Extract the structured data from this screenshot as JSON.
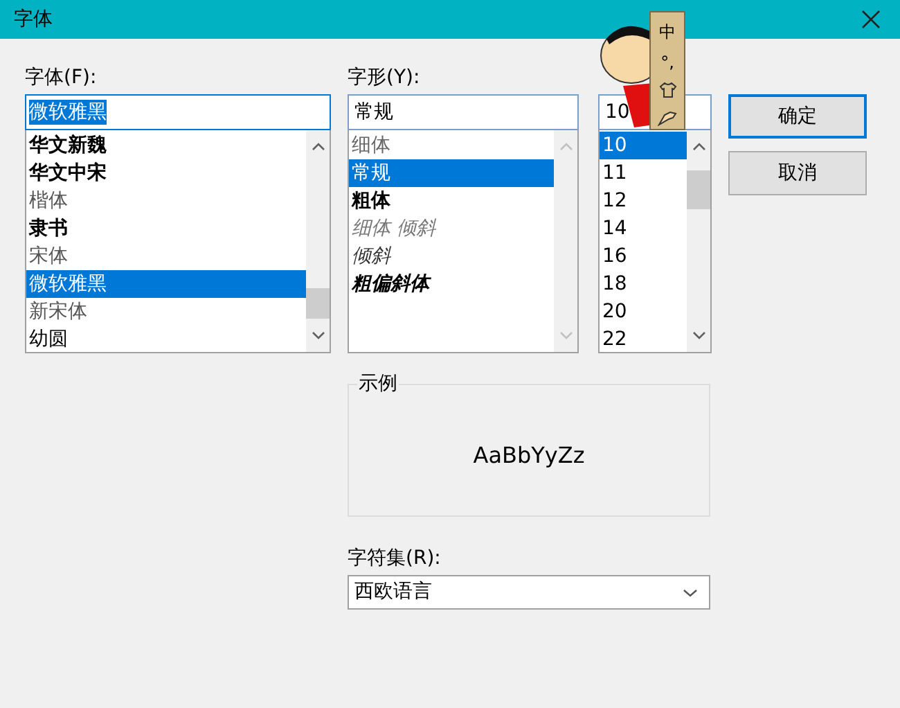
{
  "window": {
    "title": "字体"
  },
  "font": {
    "label": "字体(F):",
    "value": "微软雅黑",
    "items": [
      {
        "label": "华文新魏",
        "kind": "bold",
        "selected": false
      },
      {
        "label": "华文中宋",
        "kind": "bold",
        "selected": false
      },
      {
        "label": "楷体",
        "kind": "serif",
        "selected": false
      },
      {
        "label": "隶书",
        "kind": "bold",
        "selected": false
      },
      {
        "label": "宋体",
        "kind": "serif",
        "selected": false
      },
      {
        "label": "微软雅黑",
        "kind": "plain",
        "selected": true
      },
      {
        "label": "新宋体",
        "kind": "serif",
        "selected": false
      },
      {
        "label": "幼圆",
        "kind": "plain",
        "selected": false
      }
    ]
  },
  "style": {
    "label": "字形(Y):",
    "value": "常规",
    "items": [
      {
        "label": "细体",
        "kind": "light",
        "selected": false
      },
      {
        "label": "常规",
        "kind": "regular",
        "selected": true
      },
      {
        "label": "粗体",
        "kind": "bold",
        "selected": false
      },
      {
        "label": "细体 倾斜",
        "kind": "light-italic",
        "selected": false
      },
      {
        "label": "倾斜",
        "kind": "italic",
        "selected": false
      },
      {
        "label": "粗偏斜体",
        "kind": "bold-italic",
        "selected": false
      }
    ]
  },
  "size": {
    "value": "10",
    "items": [
      {
        "label": "10",
        "selected": true
      },
      {
        "label": "11",
        "selected": false
      },
      {
        "label": "12",
        "selected": false
      },
      {
        "label": "14",
        "selected": false
      },
      {
        "label": "16",
        "selected": false
      },
      {
        "label": "18",
        "selected": false
      },
      {
        "label": "20",
        "selected": false
      },
      {
        "label": "22",
        "selected": false
      }
    ]
  },
  "buttons": [
    {
      "label": "确定",
      "default": true
    },
    {
      "label": "取消",
      "default": false
    }
  ],
  "sample": {
    "legend": "示例",
    "text": "AaBbYyZz"
  },
  "charset": {
    "label": "字符集(R):",
    "value": "西欧语言"
  },
  "ime_toolbar": {
    "items": [
      "中",
      "°,"
    ]
  }
}
